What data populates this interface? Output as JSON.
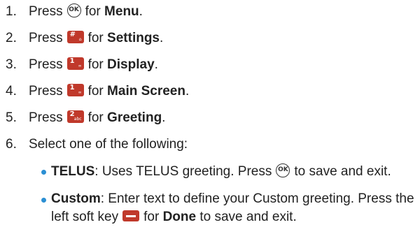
{
  "steps": [
    {
      "num": "1.",
      "pre": "Press",
      "icon": "ok-icon",
      "mid": "for",
      "bold": "Menu",
      "post": "."
    },
    {
      "num": "2.",
      "pre": "Press",
      "icon": "hash-key-icon",
      "mid": "for",
      "bold": "Settings",
      "post": "."
    },
    {
      "num": "3.",
      "pre": "Press",
      "icon": "one-key-icon",
      "mid": "for",
      "bold": "Display",
      "post": "."
    },
    {
      "num": "4.",
      "pre": "Press",
      "icon": "one-key-icon",
      "mid": "for",
      "bold": "Main Screen",
      "post": "."
    },
    {
      "num": "5.",
      "pre": "Press",
      "icon": "two-key-icon",
      "mid": "for",
      "bold": "Greeting",
      "post": "."
    },
    {
      "num": "6.",
      "text": "Select one of the following:"
    }
  ],
  "options": [
    {
      "bold": "TELUS",
      "text1": ": Uses TELUS greeting. Press",
      "icon": "ok-icon",
      "text2": "to save and exit."
    },
    {
      "bold": "Custom",
      "text1": ": Enter text to define your Custom greeting. Press the left soft key",
      "icon": "left-soft-key-icon",
      "text2": "for",
      "bold2": "Done",
      "text3": "to save and exit."
    }
  ],
  "key_labels": {
    "ok": "OK",
    "hash": "#",
    "one": "1",
    "two": "2",
    "hash_sub": "⌂",
    "one_sub": "∞",
    "two_sub": "abc"
  },
  "colors": {
    "key": "#c0392b",
    "bullet": "#2b8fd3",
    "text": "#222222"
  }
}
